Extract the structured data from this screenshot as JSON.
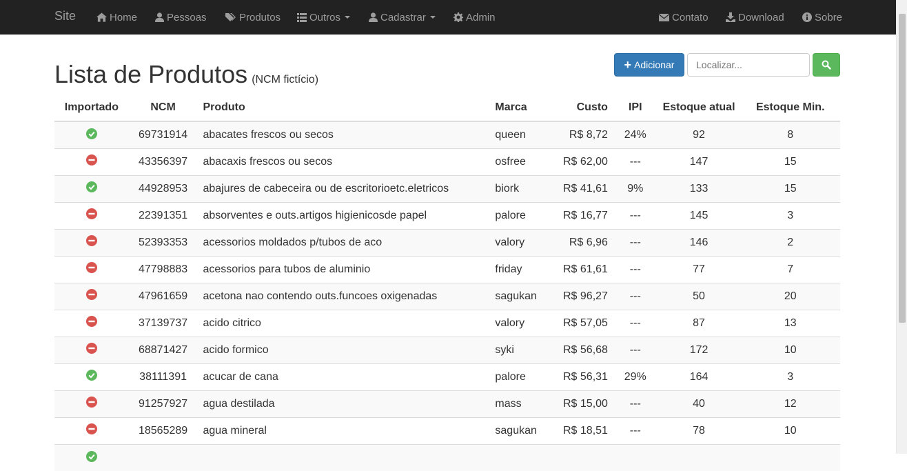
{
  "nav": {
    "brand": "Site",
    "left_items": [
      {
        "label": "Home",
        "icon": "home-icon",
        "dropdown": false
      },
      {
        "label": "Pessoas",
        "icon": "user-icon",
        "dropdown": false
      },
      {
        "label": "Produtos",
        "icon": "tags-icon",
        "dropdown": false
      },
      {
        "label": "Outros",
        "icon": "list-icon",
        "dropdown": true
      },
      {
        "label": "Cadastrar",
        "icon": "user-icon",
        "dropdown": true
      },
      {
        "label": "Admin",
        "icon": "gear-icon",
        "dropdown": false
      }
    ],
    "right_items": [
      {
        "label": "Contato",
        "icon": "envelope-icon"
      },
      {
        "label": "Download",
        "icon": "download-icon"
      },
      {
        "label": "Sobre",
        "icon": "info-icon"
      }
    ]
  },
  "page": {
    "title": "Lista de Produtos",
    "subtitle": "(NCM fictício)"
  },
  "actions": {
    "add_label": "Adicionar",
    "search_placeholder": "Localizar..."
  },
  "colors": {
    "navbar": "#222222",
    "primary": "#337ab7",
    "success": "#5cb85c",
    "danger": "#d9534f"
  },
  "table": {
    "headers": [
      "Importado",
      "NCM",
      "Produto",
      "Marca",
      "Custo",
      "IPI",
      "Estoque atual",
      "Estoque Min."
    ],
    "rows": [
      {
        "importado": true,
        "ncm": "69731914",
        "produto": "abacates frescos ou secos",
        "marca": "queen",
        "custo": "R$ 8,72",
        "ipi": "24%",
        "estoque": "92",
        "min": "8"
      },
      {
        "importado": false,
        "ncm": "43356397",
        "produto": "abacaxis frescos ou secos",
        "marca": "osfree",
        "custo": "R$ 62,00",
        "ipi": "---",
        "estoque": "147",
        "min": "15"
      },
      {
        "importado": true,
        "ncm": "44928953",
        "produto": "abajures de cabeceira ou de escritorioetc.eletricos",
        "marca": "biork",
        "custo": "R$ 41,61",
        "ipi": "9%",
        "estoque": "133",
        "min": "15"
      },
      {
        "importado": false,
        "ncm": "22391351",
        "produto": "absorventes e outs.artigos higienicosde papel",
        "marca": "palore",
        "custo": "R$ 16,77",
        "ipi": "---",
        "estoque": "145",
        "min": "3"
      },
      {
        "importado": false,
        "ncm": "52393353",
        "produto": "acessorios moldados p/tubos de aco",
        "marca": "valory",
        "custo": "R$ 6,96",
        "ipi": "---",
        "estoque": "146",
        "min": "2"
      },
      {
        "importado": false,
        "ncm": "47798883",
        "produto": "acessorios para tubos de aluminio",
        "marca": "friday",
        "custo": "R$ 61,61",
        "ipi": "---",
        "estoque": "77",
        "min": "7"
      },
      {
        "importado": false,
        "ncm": "47961659",
        "produto": "acetona nao contendo outs.funcoes oxigenadas",
        "marca": "sagukan",
        "custo": "R$ 96,27",
        "ipi": "---",
        "estoque": "50",
        "min": "20"
      },
      {
        "importado": false,
        "ncm": "37139737",
        "produto": "acido citrico",
        "marca": "valory",
        "custo": "R$ 57,05",
        "ipi": "---",
        "estoque": "87",
        "min": "13"
      },
      {
        "importado": false,
        "ncm": "68871427",
        "produto": "acido formico",
        "marca": "syki",
        "custo": "R$ 56,68",
        "ipi": "---",
        "estoque": "172",
        "min": "10"
      },
      {
        "importado": true,
        "ncm": "38111391",
        "produto": "acucar de cana",
        "marca": "palore",
        "custo": "R$ 56,31",
        "ipi": "29%",
        "estoque": "164",
        "min": "3"
      },
      {
        "importado": false,
        "ncm": "91257927",
        "produto": "agua destilada",
        "marca": "mass",
        "custo": "R$ 15,00",
        "ipi": "---",
        "estoque": "40",
        "min": "12"
      },
      {
        "importado": false,
        "ncm": "18565289",
        "produto": "agua mineral",
        "marca": "sagukan",
        "custo": "R$ 18,51",
        "ipi": "---",
        "estoque": "78",
        "min": "10"
      },
      {
        "importado": true,
        "ncm": "",
        "produto": "",
        "marca": "",
        "custo": "",
        "ipi": "",
        "estoque": "",
        "min": ""
      }
    ]
  }
}
